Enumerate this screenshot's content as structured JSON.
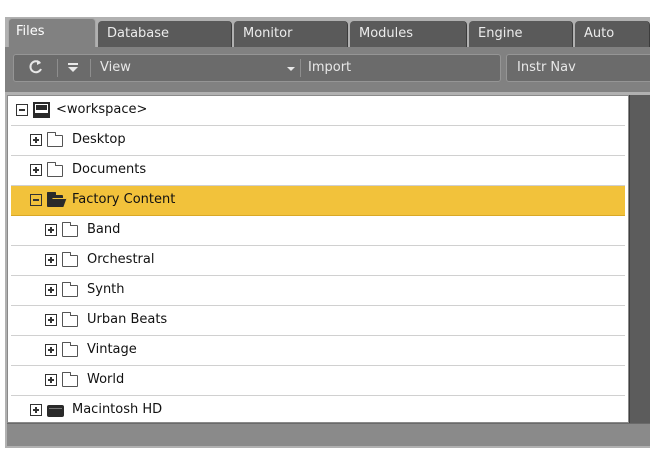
{
  "tabs": [
    {
      "label": "Files",
      "active": true
    },
    {
      "label": "Database",
      "active": false
    },
    {
      "label": "Monitor",
      "active": false
    },
    {
      "label": "Modules",
      "active": false
    },
    {
      "label": "Engine",
      "active": false
    },
    {
      "label": "Auto",
      "active": false
    }
  ],
  "toolbar": {
    "refresh_icon": "refresh-icon",
    "menu_icon": "down-triangle-menu-icon",
    "view_label": "View",
    "view_dropdown_icon": "dropdown-arrow-icon",
    "import_label": "Import",
    "instr_nav_label": "Instr Nav"
  },
  "tree": {
    "workspace": "<workspace>",
    "items": [
      {
        "label": "Desktop",
        "icon": "folder-icon"
      },
      {
        "label": "Documents",
        "icon": "folder-icon"
      },
      {
        "label": "Factory Content",
        "icon": "open-folder-icon",
        "selected": true,
        "expanded": true
      },
      {
        "label": "Band",
        "icon": "folder-icon"
      },
      {
        "label": "Orchestral",
        "icon": "folder-icon"
      },
      {
        "label": "Synth",
        "icon": "folder-icon"
      },
      {
        "label": "Urban Beats",
        "icon": "folder-icon"
      },
      {
        "label": "Vintage",
        "icon": "folder-icon"
      },
      {
        "label": "World",
        "icon": "folder-icon"
      },
      {
        "label": "Macintosh HD",
        "icon": "hard-drive-icon"
      }
    ]
  },
  "colors": {
    "selection": "#f2c23b",
    "panel": "#b1b1b1",
    "toolbar": "#818181",
    "tab": "#5a5a5a"
  }
}
